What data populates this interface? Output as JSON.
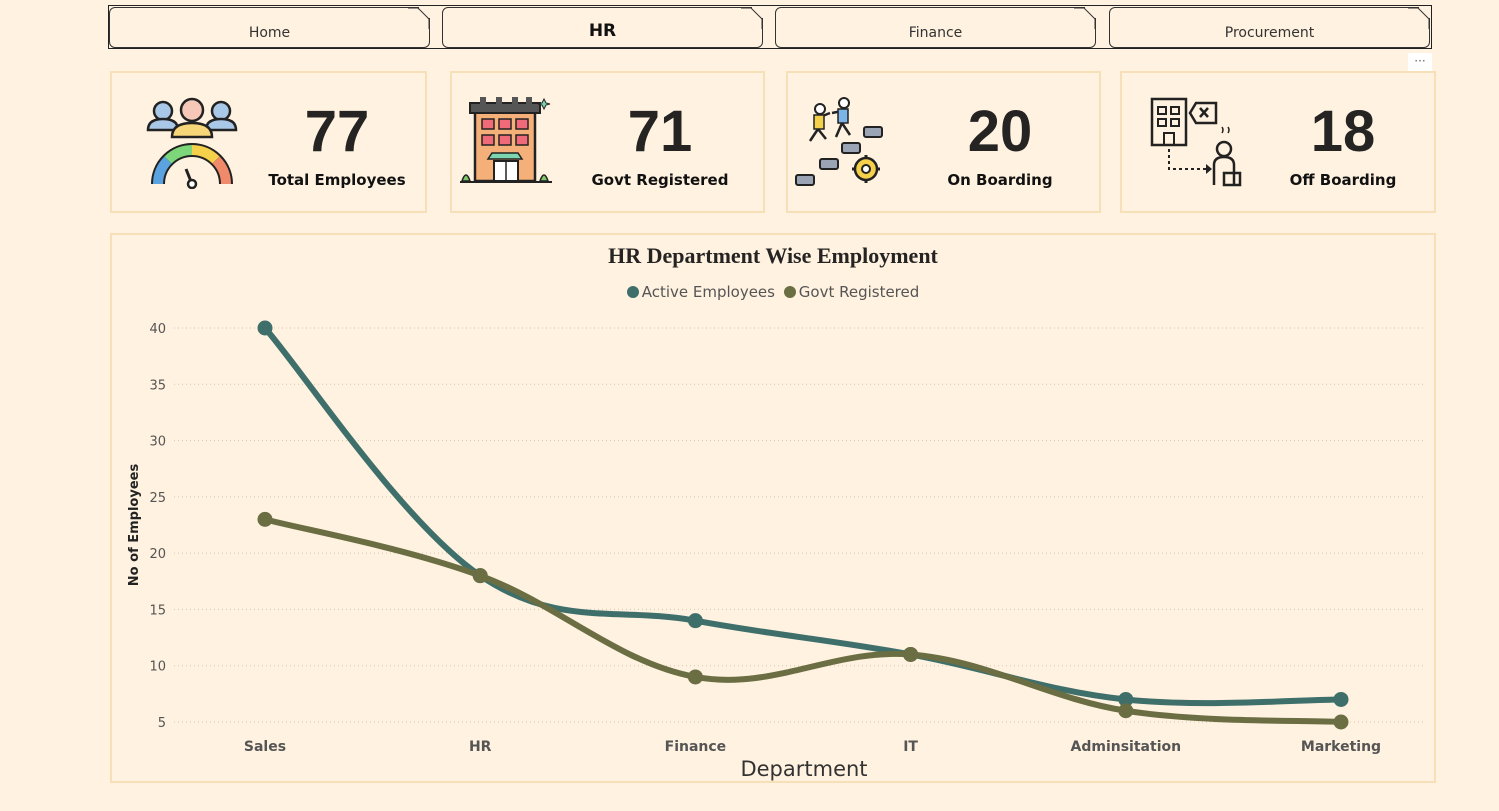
{
  "tabs": [
    {
      "label": "Home",
      "active": false
    },
    {
      "label": "HR",
      "active": true
    },
    {
      "label": "Finance",
      "active": false
    },
    {
      "label": "Procurement",
      "active": false
    }
  ],
  "more_options": "···",
  "kpis": [
    {
      "value": "77",
      "label": "Total Employees",
      "icon": "employees-gauge-icon"
    },
    {
      "value": "71",
      "label": "Govt Registered",
      "icon": "building-icon"
    },
    {
      "value": "20",
      "label": "On Boarding",
      "icon": "onboarding-steps-icon"
    },
    {
      "value": "18",
      "label": "Off Boarding",
      "icon": "offboarding-icon"
    }
  ],
  "colors": {
    "background": "#fff2e0",
    "card_border": "#f7dfb8",
    "active_series": "#3f6f6b",
    "govt_series": "#6b6e42"
  },
  "chart_data": {
    "type": "line",
    "title": "HR Department Wise Employment",
    "xlabel": "Department",
    "ylabel": "No of Employees",
    "categories": [
      "Sales",
      "HR",
      "Finance",
      "IT",
      "Adminsitation",
      "Marketing"
    ],
    "series": [
      {
        "name": "Active Employees",
        "values": [
          40,
          18,
          14,
          11,
          7,
          7
        ],
        "color": "#3f6f6b"
      },
      {
        "name": "Govt Registered",
        "values": [
          23,
          18,
          9,
          11,
          6,
          5
        ],
        "color": "#6b6e42"
      }
    ],
    "ylim": [
      5,
      40
    ],
    "yticks": [
      5,
      10,
      15,
      20,
      25,
      30,
      35,
      40
    ],
    "grid": true,
    "legend": "top-center"
  }
}
